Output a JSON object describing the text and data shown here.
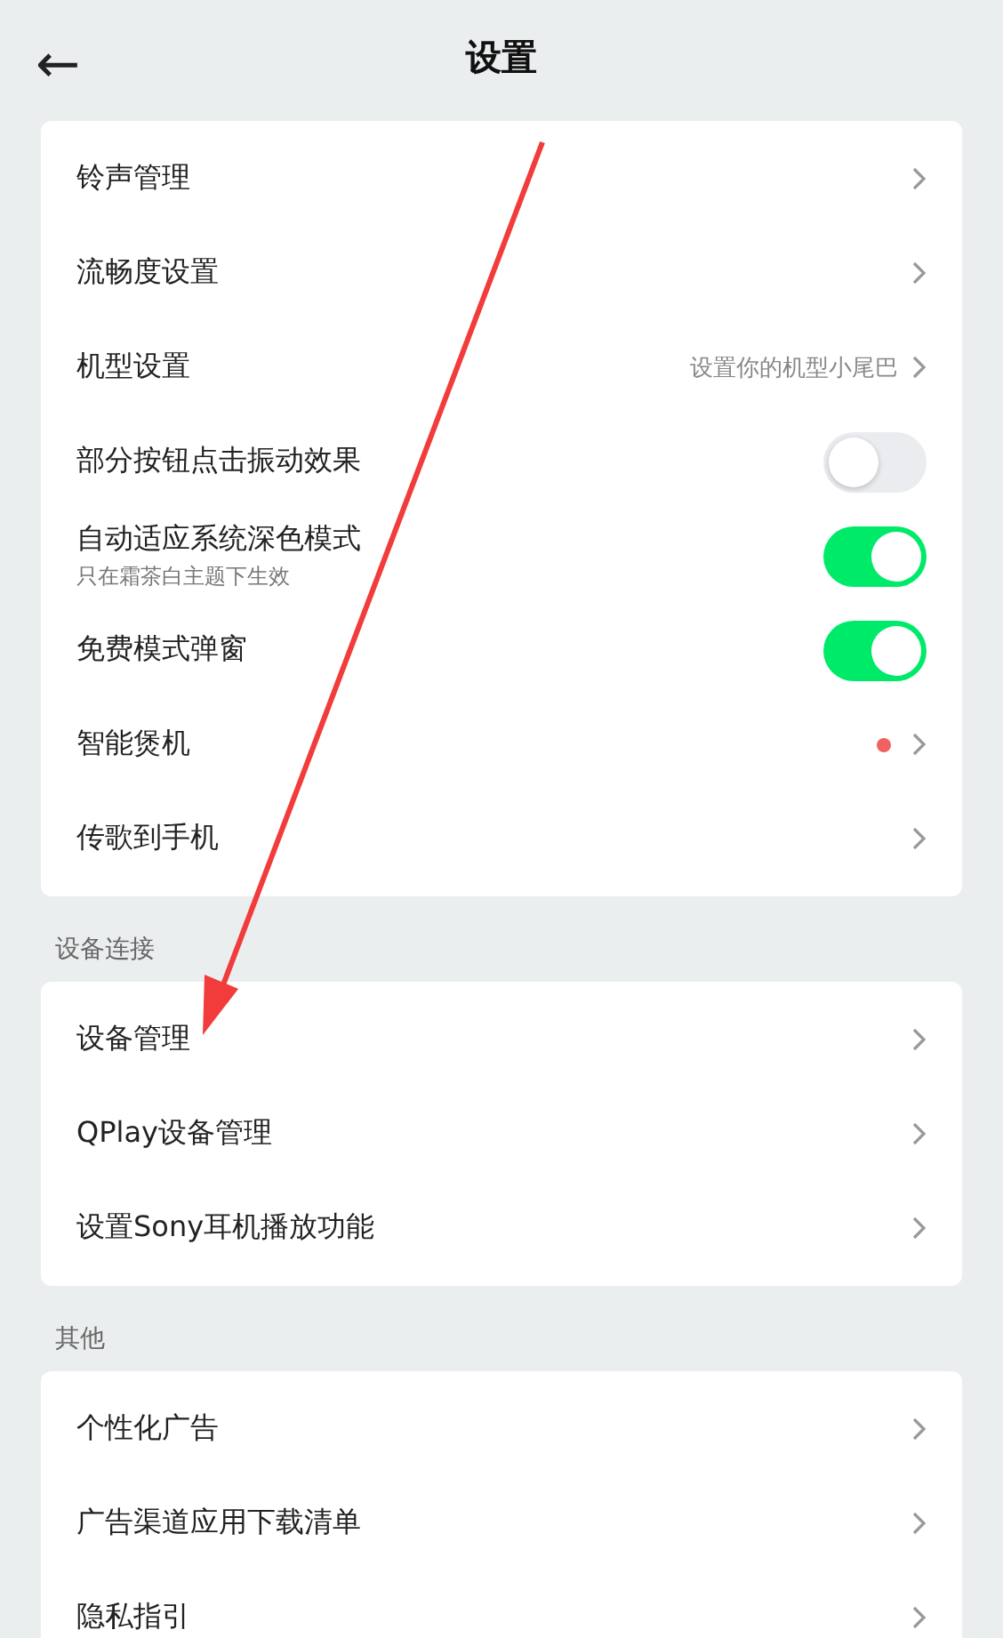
{
  "header": {
    "title": "设置",
    "back": "←"
  },
  "sections": [
    {
      "items": [
        {
          "kind": "link",
          "label": "铃声管理"
        },
        {
          "kind": "link",
          "label": "流畅度设置"
        },
        {
          "kind": "link",
          "label": "机型设置",
          "value": "设置你的机型小尾巴"
        },
        {
          "kind": "toggle",
          "label": "部分按钮点击振动效果",
          "on": false
        },
        {
          "kind": "toggle",
          "label": "自动适应系统深色模式",
          "sub": "只在霜茶白主题下生效",
          "on": true
        },
        {
          "kind": "toggle",
          "label": "免费模式弹窗",
          "on": true
        },
        {
          "kind": "link",
          "label": "智能煲机",
          "dot": true
        },
        {
          "kind": "link",
          "label": "传歌到手机"
        }
      ]
    },
    {
      "title": "设备连接",
      "items": [
        {
          "kind": "link",
          "label": "设备管理"
        },
        {
          "kind": "link",
          "label": "QPlay设备管理"
        },
        {
          "kind": "link",
          "label": "设置Sony耳机播放功能"
        }
      ]
    },
    {
      "title": "其他",
      "items": [
        {
          "kind": "link",
          "label": "个性化广告"
        },
        {
          "kind": "link",
          "label": "广告渠道应用下载清单"
        },
        {
          "kind": "link",
          "label": "隐私指引"
        }
      ]
    }
  ],
  "annotation": {
    "kind": "arrow"
  }
}
